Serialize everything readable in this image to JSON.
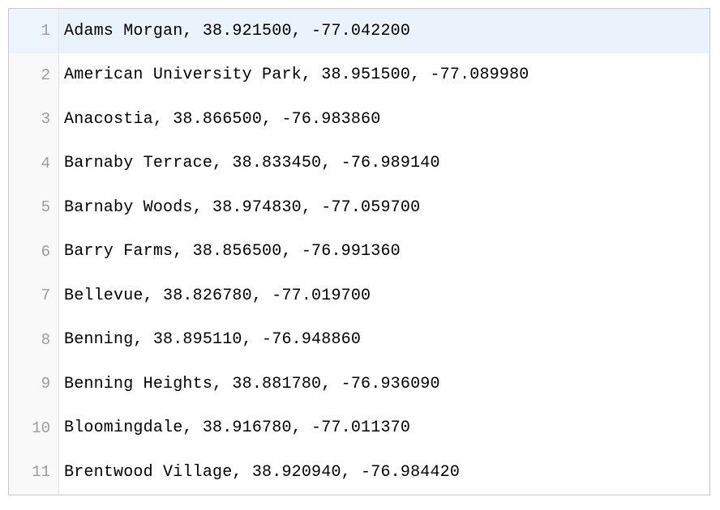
{
  "editor": {
    "highlighted_line": 1,
    "lines": [
      {
        "number": 1,
        "text": "Adams Morgan, 38.921500, -77.042200"
      },
      {
        "number": 2,
        "text": "American University Park, 38.951500, -77.089980"
      },
      {
        "number": 3,
        "text": "Anacostia, 38.866500, -76.983860"
      },
      {
        "number": 4,
        "text": "Barnaby Terrace, 38.833450, -76.989140"
      },
      {
        "number": 5,
        "text": "Barnaby Woods, 38.974830, -77.059700"
      },
      {
        "number": 6,
        "text": "Barry Farms, 38.856500, -76.991360"
      },
      {
        "number": 7,
        "text": "Bellevue, 38.826780, -77.019700"
      },
      {
        "number": 8,
        "text": "Benning, 38.895110, -76.948860"
      },
      {
        "number": 9,
        "text": "Benning Heights, 38.881780, -76.936090"
      },
      {
        "number": 10,
        "text": "Bloomingdale, 38.916780, -77.011370"
      },
      {
        "number": 11,
        "text": "Brentwood Village, 38.920940, -76.984420"
      }
    ]
  }
}
